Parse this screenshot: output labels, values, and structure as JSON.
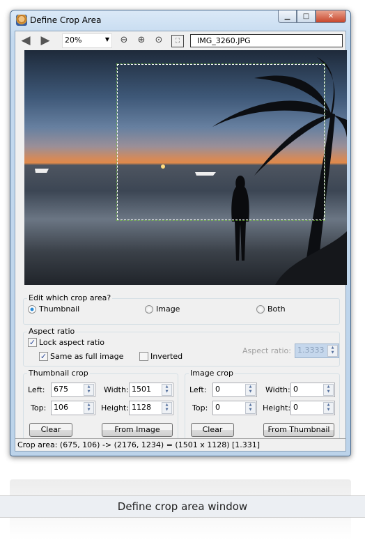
{
  "window": {
    "title": "Define Crop Area",
    "minimize": "▭",
    "maximize": "□",
    "close": "✕"
  },
  "toolbar": {
    "back_icon": "arrow-left",
    "forward_icon": "arrow-right",
    "zoom": "20%",
    "filename": "IMG_3260.JPG"
  },
  "edit_area": {
    "label": "Edit which crop area?",
    "options": [
      "Thumbnail",
      "Image",
      "Both"
    ],
    "selected": "Thumbnail"
  },
  "aspect": {
    "label": "Aspect ratio",
    "lock": "Lock aspect ratio",
    "lock_checked": true,
    "same": "Same as full image",
    "same_checked": true,
    "inverted": "Inverted",
    "inverted_checked": false,
    "ratio_label": "Aspect ratio:",
    "ratio_value": "1.3333"
  },
  "thumb": {
    "label": "Thumbnail crop",
    "left_label": "Left:",
    "left": "675",
    "top_label": "Top:",
    "top": "106",
    "width_label": "Width:",
    "width": "1501",
    "height_label": "Height:",
    "height": "1128",
    "clear": "Clear",
    "from": "From Image"
  },
  "image": {
    "label": "Image crop",
    "left_label": "Left:",
    "left": "0",
    "top_label": "Top:",
    "top": "0",
    "width_label": "Width:",
    "width": "0",
    "height_label": "Height:",
    "height": "0",
    "clear": "Clear",
    "from": "From Thumbnail"
  },
  "status": "Crop area: (675, 106) -> (2176, 1234) = (1501 x 1128) [1.331]",
  "caption": "Define crop area window"
}
